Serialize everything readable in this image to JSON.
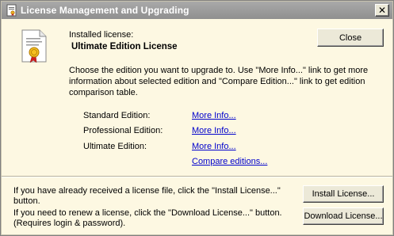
{
  "window": {
    "title": "License Management and Upgrading",
    "close_glyph": "✕"
  },
  "license": {
    "installed_label": "Installed license:",
    "installed_value": "Ultimate Edition License"
  },
  "buttons": {
    "close": "Close",
    "install": "Install License...",
    "download": "Download License..."
  },
  "description": "Choose the edition you want to upgrade to. Use \"More Info...\" link to get more information about selected edition and \"Compare Edition...\" link to get edition comparison table.",
  "editions": [
    {
      "label": "Standard Edition:",
      "link": "More Info..."
    },
    {
      "label": "Professional Edition:",
      "link": "More Info..."
    },
    {
      "label": "Ultimate Edition:",
      "link": "More Info..."
    }
  ],
  "compare_link": "Compare editions...",
  "footer": {
    "install_text": "If you have already received a license file, click the \"Install License...\" button.",
    "download_text": "If you need to renew a license, click the \"Download License...\" button. (Requires login & password)."
  },
  "icons": {
    "app": "license-app-icon",
    "certificate": "certificate-icon"
  },
  "colors": {
    "background": "#fdf8e2",
    "titlebar": "#9a9a9a",
    "link": "#0000cc"
  }
}
